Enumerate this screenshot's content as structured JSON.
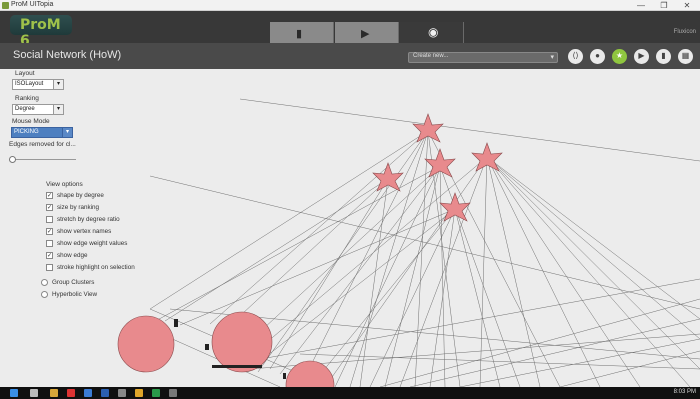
{
  "window": {
    "title": "ProM UITopia",
    "minimize": "—",
    "maximize": "❐",
    "close": "✕"
  },
  "header": {
    "logo": "ProM 6",
    "tabs": [
      {
        "name": "workspace",
        "icon": "▮"
      },
      {
        "name": "actions",
        "icon": "▶"
      },
      {
        "name": "views",
        "icon": "◉"
      }
    ],
    "brand": "Fluxicon"
  },
  "view": {
    "title": "Social Network (HoW)",
    "create_placeholder": "Create new...",
    "create_arrow": "▾",
    "buttons": [
      {
        "icon": "⟨⟩"
      },
      {
        "icon": "●"
      },
      {
        "icon": "★"
      },
      {
        "icon": "▶"
      },
      {
        "icon": "▮"
      },
      {
        "icon": "▦"
      }
    ]
  },
  "options": {
    "layout_label": "Layout",
    "layout_value": "ISOLayout",
    "ranking_label": "Ranking",
    "ranking_value": "Degree",
    "mouse_label": "Mouse Mode",
    "mouse_value": "PICKING",
    "edges_label": "Edges removed for cl...",
    "view_options_label": "View options",
    "checks": [
      {
        "label": "shape by degree",
        "checked": true
      },
      {
        "label": "size by ranking",
        "checked": true
      },
      {
        "label": "stretch by degree ratio",
        "checked": false
      },
      {
        "label": "show vertex names",
        "checked": true
      },
      {
        "label": "show edge weight values",
        "checked": false
      },
      {
        "label": "show edge",
        "checked": true
      },
      {
        "label": "stroke highlight on selection",
        "checked": false
      }
    ],
    "radios": [
      {
        "label": "Group Clusters"
      },
      {
        "label": "Hyperbolic View"
      }
    ],
    "dropdown_arrow": "▾"
  },
  "tray": {
    "time": "8:03 PM"
  }
}
